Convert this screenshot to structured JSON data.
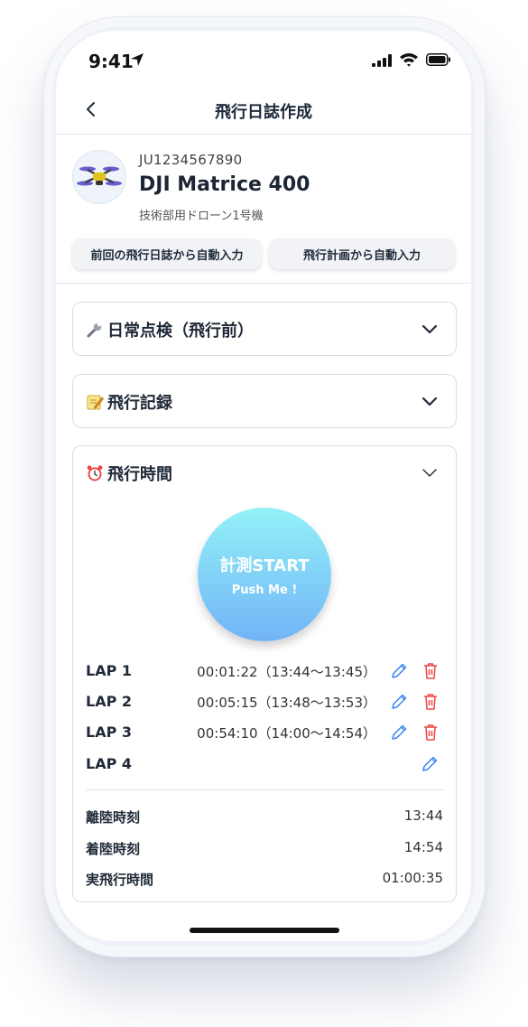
{
  "status_bar": {
    "time": "9:41"
  },
  "nav": {
    "title": "飛行日誌作成"
  },
  "drone": {
    "registration": "JU1234567890",
    "model": "DJI Matrice 400",
    "nickname": "技術部用ドローン1号機"
  },
  "buttons": {
    "from_previous_log": "前回の飛行日誌から自動入力",
    "from_flight_plan": "飛行計画から自動入力"
  },
  "sections": {
    "daily_check": {
      "icon": "wrench-icon",
      "label": "日常点検（飛行前）"
    },
    "flight_record": {
      "icon": "memo-icon",
      "label": "飛行記録"
    },
    "flight_time": {
      "icon": "alarm-clock-icon",
      "label": "飛行時間"
    }
  },
  "timer": {
    "start_label": "計測START",
    "start_sub": "Push Me !"
  },
  "laps": [
    {
      "name": "LAP 1",
      "time": "00:01:22（13:44〜13:45）",
      "deletable": true
    },
    {
      "name": "LAP 2",
      "time": "00:05:15（13:48〜13:53）",
      "deletable": true
    },
    {
      "name": "LAP 3",
      "time": "00:54:10（14:00〜14:54）",
      "deletable": true
    },
    {
      "name": "LAP 4",
      "time": "",
      "deletable": false
    }
  ],
  "summary": {
    "takeoff_label": "離陸時刻",
    "takeoff_value": "13:44",
    "landing_label": "着陸時刻",
    "landing_value": "14:54",
    "total_label": "実飛行時間",
    "total_value": "01:00:35"
  },
  "colors": {
    "accent_blue": "#3b82f6",
    "delete_red": "#ef4444",
    "title_navy": "#1e2a3b"
  }
}
